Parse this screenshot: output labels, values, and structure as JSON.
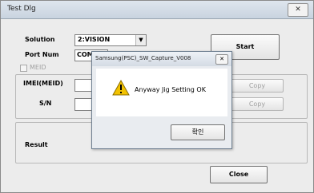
{
  "window": {
    "title": "Test Dlg",
    "close_glyph": "✕"
  },
  "form": {
    "solution_label": "Solution",
    "solution_value": "2:VISION",
    "port_label": "Port Num",
    "port_value": "COM002",
    "meid_label": "MEID",
    "imei_label": "IMEI(MEID)",
    "sn_label": "S/N",
    "result_label": "Result",
    "imei_value": "",
    "sn_value": ""
  },
  "buttons": {
    "start": "Start",
    "copy_imei": "Copy",
    "copy_sn": "Copy",
    "close": "Close"
  },
  "dialog": {
    "title": "Samsung(PSC)_SW_Capture_V008",
    "close_glyph": "✕",
    "message": "Anyway Jig Setting OK",
    "ok": "확인",
    "icon": "warning-icon"
  }
}
